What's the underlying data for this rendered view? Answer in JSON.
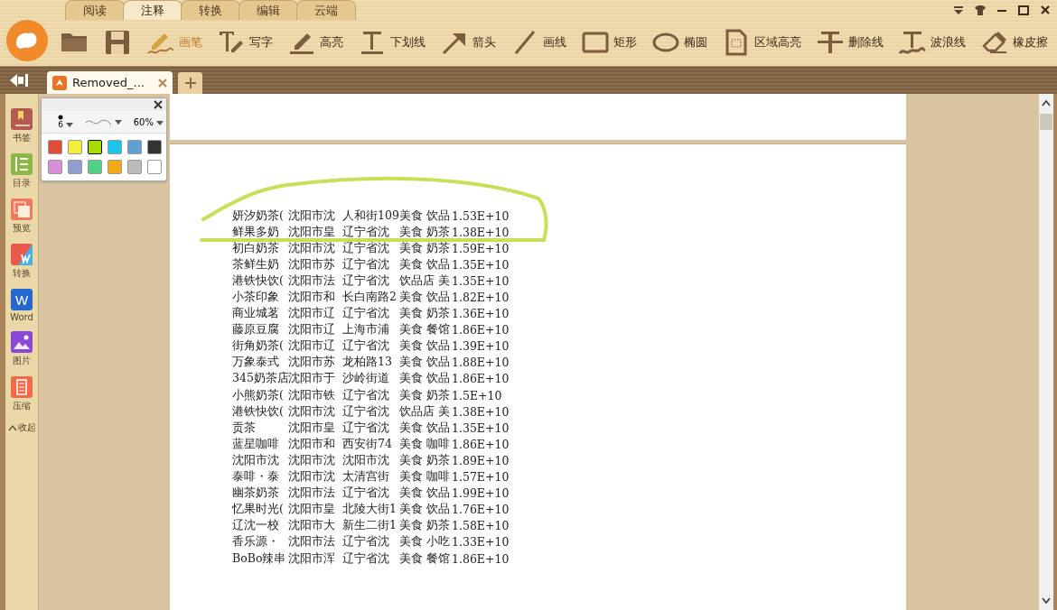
{
  "menu_tabs": [
    {
      "label": "阅读",
      "selected": false
    },
    {
      "label": "注释",
      "selected": true
    },
    {
      "label": "转换",
      "selected": false
    },
    {
      "label": "编辑",
      "selected": false
    },
    {
      "label": "云端",
      "selected": false
    }
  ],
  "toolbar": [
    {
      "kind": "open"
    },
    {
      "kind": "save"
    },
    {
      "kind": "pen",
      "label": "画笔",
      "selected": true
    },
    {
      "kind": "text",
      "label": "写字",
      "selected": false
    },
    {
      "kind": "highlight",
      "label": "高亮",
      "selected": false
    },
    {
      "kind": "underline",
      "label": "下划线",
      "selected": false
    },
    {
      "kind": "arrow",
      "label": "箭头",
      "selected": false
    },
    {
      "kind": "line",
      "label": "画线",
      "selected": false
    },
    {
      "kind": "rect",
      "label": "矩形",
      "selected": false
    },
    {
      "kind": "ellipse",
      "label": "椭圆",
      "selected": false
    },
    {
      "kind": "area",
      "label": "区域高亮",
      "selected": false
    },
    {
      "kind": "strike",
      "label": "删除线",
      "selected": false
    },
    {
      "kind": "wave",
      "label": "波浪线",
      "selected": false
    },
    {
      "kind": "eraser",
      "label": "橡皮擦",
      "selected": false
    }
  ],
  "document_tab": {
    "title": "Removed_..."
  },
  "sidebar": [
    {
      "kind": "bookmark",
      "label": "书签"
    },
    {
      "kind": "toc",
      "label": "目录"
    },
    {
      "kind": "preview",
      "label": "预览"
    },
    {
      "kind": "convert",
      "label": "转换"
    },
    {
      "kind": "word",
      "label": "Word",
      "icon_text": "W"
    },
    {
      "kind": "image",
      "label": "图片"
    },
    {
      "kind": "compress",
      "label": "压缩"
    }
  ],
  "sidebar_collapse": "收起",
  "pen_popup": {
    "size": "6",
    "opacity": "60%",
    "colors": [
      {
        "color": "#e04c3a",
        "selected": false
      },
      {
        "color": "#f2ee3a",
        "selected": false
      },
      {
        "color": "#a8dc00",
        "selected": true
      },
      {
        "color": "#1ec4e8",
        "selected": false
      },
      {
        "color": "#62a0d4",
        "selected": false
      },
      {
        "color": "#333333",
        "selected": false
      },
      {
        "color": "#d88ed8",
        "selected": false
      },
      {
        "color": "#8e9ed0",
        "selected": false
      },
      {
        "color": "#52d08a",
        "selected": false
      },
      {
        "color": "#f2aa1a",
        "selected": false
      },
      {
        "color": "#bbbbbb",
        "selected": false
      },
      {
        "color": "#ffffff",
        "selected": false
      }
    ]
  },
  "document_rows": [
    [
      "妍汐奶茶(",
      "沈阳市沈",
      "人和街109",
      "美食 饮品",
      "1.53E+10"
    ],
    [
      "鲜果多奶",
      "沈阳市皇",
      "辽宁省沈",
      "美食 奶茶",
      "1.38E+10"
    ],
    [
      "初白奶茶",
      "沈阳市沈",
      "辽宁省沈",
      "美食 奶茶",
      "1.59E+10"
    ],
    [
      "茶鲜生奶",
      "沈阳市苏",
      "辽宁省沈",
      "美食 饮品",
      "1.35E+10"
    ],
    [
      "港铁快饮(",
      "沈阳市法",
      "辽宁省沈",
      "饮品店 美",
      "1.35E+10"
    ],
    [
      "小茶印象",
      "沈阳市和",
      "长白南路2",
      "美食 饮品",
      "1.82E+10"
    ],
    [
      "商业城茗",
      "沈阳市辽",
      "辽宁省沈",
      "美食 奶茶",
      "1.36E+10"
    ],
    [
      "藤原豆腐",
      "沈阳市辽",
      "上海市浦",
      "美食 餐馆",
      "1.86E+10"
    ],
    [
      "街角奶茶(",
      "沈阳市辽",
      "辽宁省沈",
      "美食 饮品",
      "1.39E+10"
    ],
    [
      "万象泰式",
      "沈阳市苏",
      "龙柏路13",
      "美食 饮品",
      "1.88E+10"
    ],
    [
      "345奶茶店",
      "沈阳市于",
      "沙岭街道",
      "美食 饮品",
      "1.86E+10"
    ],
    [
      "小熊奶茶(",
      "沈阳市铁",
      "辽宁省沈",
      "美食 奶茶",
      "1.5E+10"
    ],
    [
      "港铁快饮(",
      "沈阳市沈",
      "辽宁省沈",
      "饮品店 美",
      "1.38E+10"
    ],
    [
      "贡茶",
      "沈阳市皇",
      "辽宁省沈",
      "美食 饮品",
      "1.35E+10"
    ],
    [
      "蓝星咖啡",
      "沈阳市和",
      "西安街74",
      "美食 咖啡",
      "1.86E+10"
    ],
    [
      "沈阳市沈",
      "沈阳市沈",
      "沈阳市沈",
      "美食 奶茶",
      "1.89E+10"
    ],
    [
      "泰啡・泰",
      "沈阳市沈",
      "太清宫街",
      "美食 咖啡",
      "1.57E+10"
    ],
    [
      "幽茶奶茶",
      "沈阳市法",
      "辽宁省沈",
      "美食 饮品",
      "1.99E+10"
    ],
    [
      "忆果时光(",
      "沈阳市皇",
      "北陵大街1",
      "美食 饮品",
      "1.76E+10"
    ],
    [
      "辽沈一校",
      "沈阳市大",
      "新生二街1",
      "美食 奶茶",
      "1.58E+10"
    ],
    [
      "香乐源・",
      "沈阳市法",
      "辽宁省沈",
      "美食 小吃",
      "1.33E+10"
    ],
    [
      "BoBo辣串",
      "沈阳市浑",
      "辽宁省沈",
      "美食 餐馆",
      "1.86E+10"
    ]
  ]
}
